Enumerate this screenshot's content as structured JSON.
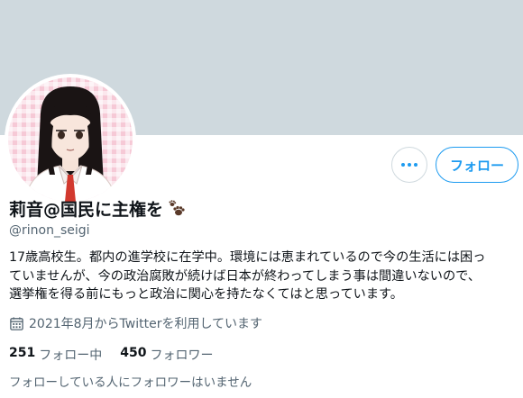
{
  "profile": {
    "display_name": "莉音@国民に主権を",
    "handle": "@rinon_seigi",
    "bio_lines": [
      "17歳高校生。都内の進学校に在学中。環境には恵まれているので今の生活には困っ",
      "ていませんが、今の政治腐敗が続けば日本が終わってしまう事は間違いないので、",
      "選挙権を得る前にもっと政治に関心を持たなくてはと思っています。"
    ],
    "joined": "2021年8月からTwitterを利用しています",
    "name_emoji_icon": "paw-prints-icon",
    "joined_icon": "calendar-icon"
  },
  "actions": {
    "more_icon": "more-horizontal-icon",
    "follow_label": "フォロー"
  },
  "stats": {
    "following_count": "251",
    "following_label": "フォロー中",
    "followers_count": "450",
    "followers_label": "フォロワー"
  },
  "followers_you_know": "フォローしている人にフォロワーはいません",
  "colors": {
    "banner": "#cfd9de",
    "accent": "#1d9bf0",
    "secondary_text": "#536471",
    "avatar_bg": "#f6c9d6"
  }
}
